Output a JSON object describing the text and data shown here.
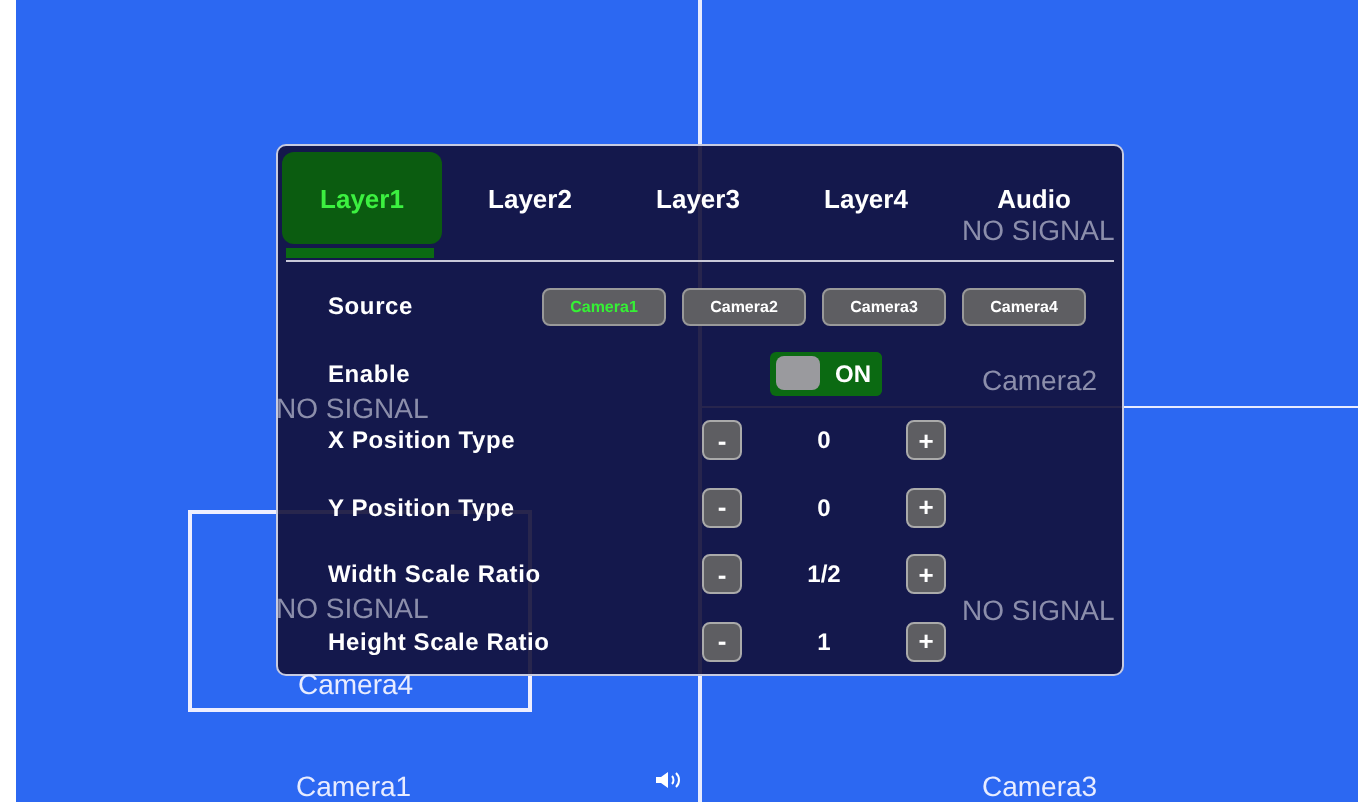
{
  "video_wall": {
    "labels": [
      {
        "text": "NO SIGNAL"
      },
      {
        "text": "Camera2"
      },
      {
        "text": "NO SIGNAL"
      },
      {
        "text": "NO SIGNAL"
      },
      {
        "text": "NO SIGNAL"
      },
      {
        "text": "Camera4"
      },
      {
        "text": "Camera1"
      },
      {
        "text": "Camera3"
      }
    ]
  },
  "menu": {
    "tabs": [
      {
        "label": "Layer1",
        "selected": true
      },
      {
        "label": "Layer2",
        "selected": false
      },
      {
        "label": "Layer3",
        "selected": false
      },
      {
        "label": "Layer4",
        "selected": false
      },
      {
        "label": "Audio",
        "selected": false
      }
    ],
    "rows": [
      {
        "kind": "source",
        "label": "Source",
        "options": [
          {
            "label": "Camera1",
            "selected": true
          },
          {
            "label": "Camera2",
            "selected": false
          },
          {
            "label": "Camera3",
            "selected": false
          },
          {
            "label": "Camera4",
            "selected": false
          }
        ]
      },
      {
        "kind": "toggle",
        "label": "Enable",
        "on": true,
        "state_label": "ON"
      },
      {
        "kind": "stepper",
        "label": "X Position Type",
        "minus": "-",
        "value": "0",
        "plus": "+"
      },
      {
        "kind": "stepper",
        "label": "Y Position Type",
        "minus": "-",
        "value": "0",
        "plus": "+"
      },
      {
        "kind": "stepper",
        "label": "Width Scale Ratio",
        "minus": "-",
        "value": "1/2",
        "plus": "+"
      },
      {
        "kind": "stepper",
        "label": "Height Scale Ratio",
        "minus": "-",
        "value": "1",
        "plus": "+"
      }
    ]
  }
}
